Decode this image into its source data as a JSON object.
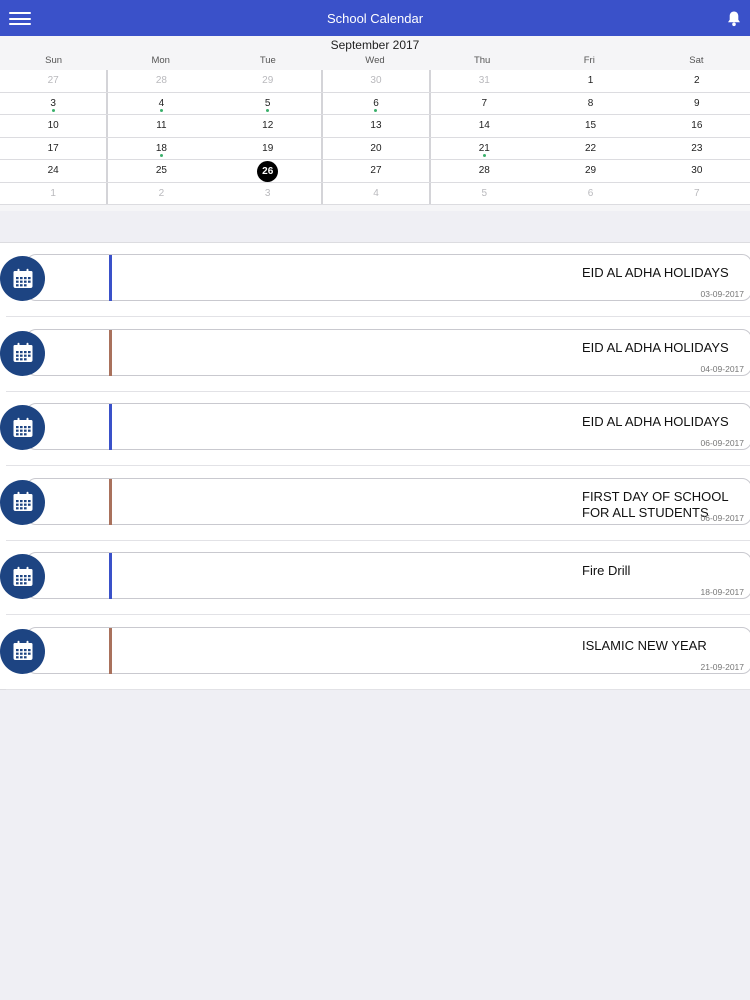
{
  "header": {
    "title": "School Calendar"
  },
  "calendar": {
    "month": "September 2017",
    "days_of_week": [
      "Sun",
      "Mon",
      "Tue",
      "Wed",
      "Thu",
      "Fri",
      "Sat"
    ],
    "weeks": [
      [
        "27",
        "28",
        "29",
        "30",
        "31",
        "1",
        "2"
      ],
      [
        "3",
        "4",
        "5",
        "6",
        "7",
        "8",
        "9"
      ],
      [
        "10",
        "11",
        "12",
        "13",
        "14",
        "15",
        "16"
      ],
      [
        "17",
        "18",
        "19",
        "20",
        "21",
        "22",
        "23"
      ],
      [
        "24",
        "25",
        "26",
        "27",
        "28",
        "29",
        "30"
      ],
      [
        "1",
        "2",
        "3",
        "4",
        "5",
        "6",
        "7"
      ]
    ],
    "selected_day": "26",
    "event_marker_color": "#3bb06b"
  },
  "events": [
    {
      "title": "EID AL ADHA HOLIDAYS",
      "date": "03-09-2017",
      "accent": "#3a51c9"
    },
    {
      "title": "EID AL ADHA HOLIDAYS",
      "date": "04-09-2017",
      "accent": "#a9715c"
    },
    {
      "title": "EID AL ADHA HOLIDAYS",
      "date": "06-09-2017",
      "accent": "#3a51c9"
    },
    {
      "title": "FIRST DAY OF SCHOOL FOR ALL STUDENTS",
      "date": "06-09-2017",
      "accent": "#a9715c"
    },
    {
      "title": "Fire Drill",
      "date": "18-09-2017",
      "accent": "#3a51c9"
    },
    {
      "title": "ISLAMIC NEW YEAR",
      "date": "21-09-2017",
      "accent": "#a9715c"
    }
  ],
  "icons": {
    "menu": "hamburger-icon",
    "notifications": "bell-icon",
    "event": "calendar-icon"
  },
  "colors": {
    "header_bg": "#3a51c9",
    "event_icon_bg": "#1d4482"
  }
}
